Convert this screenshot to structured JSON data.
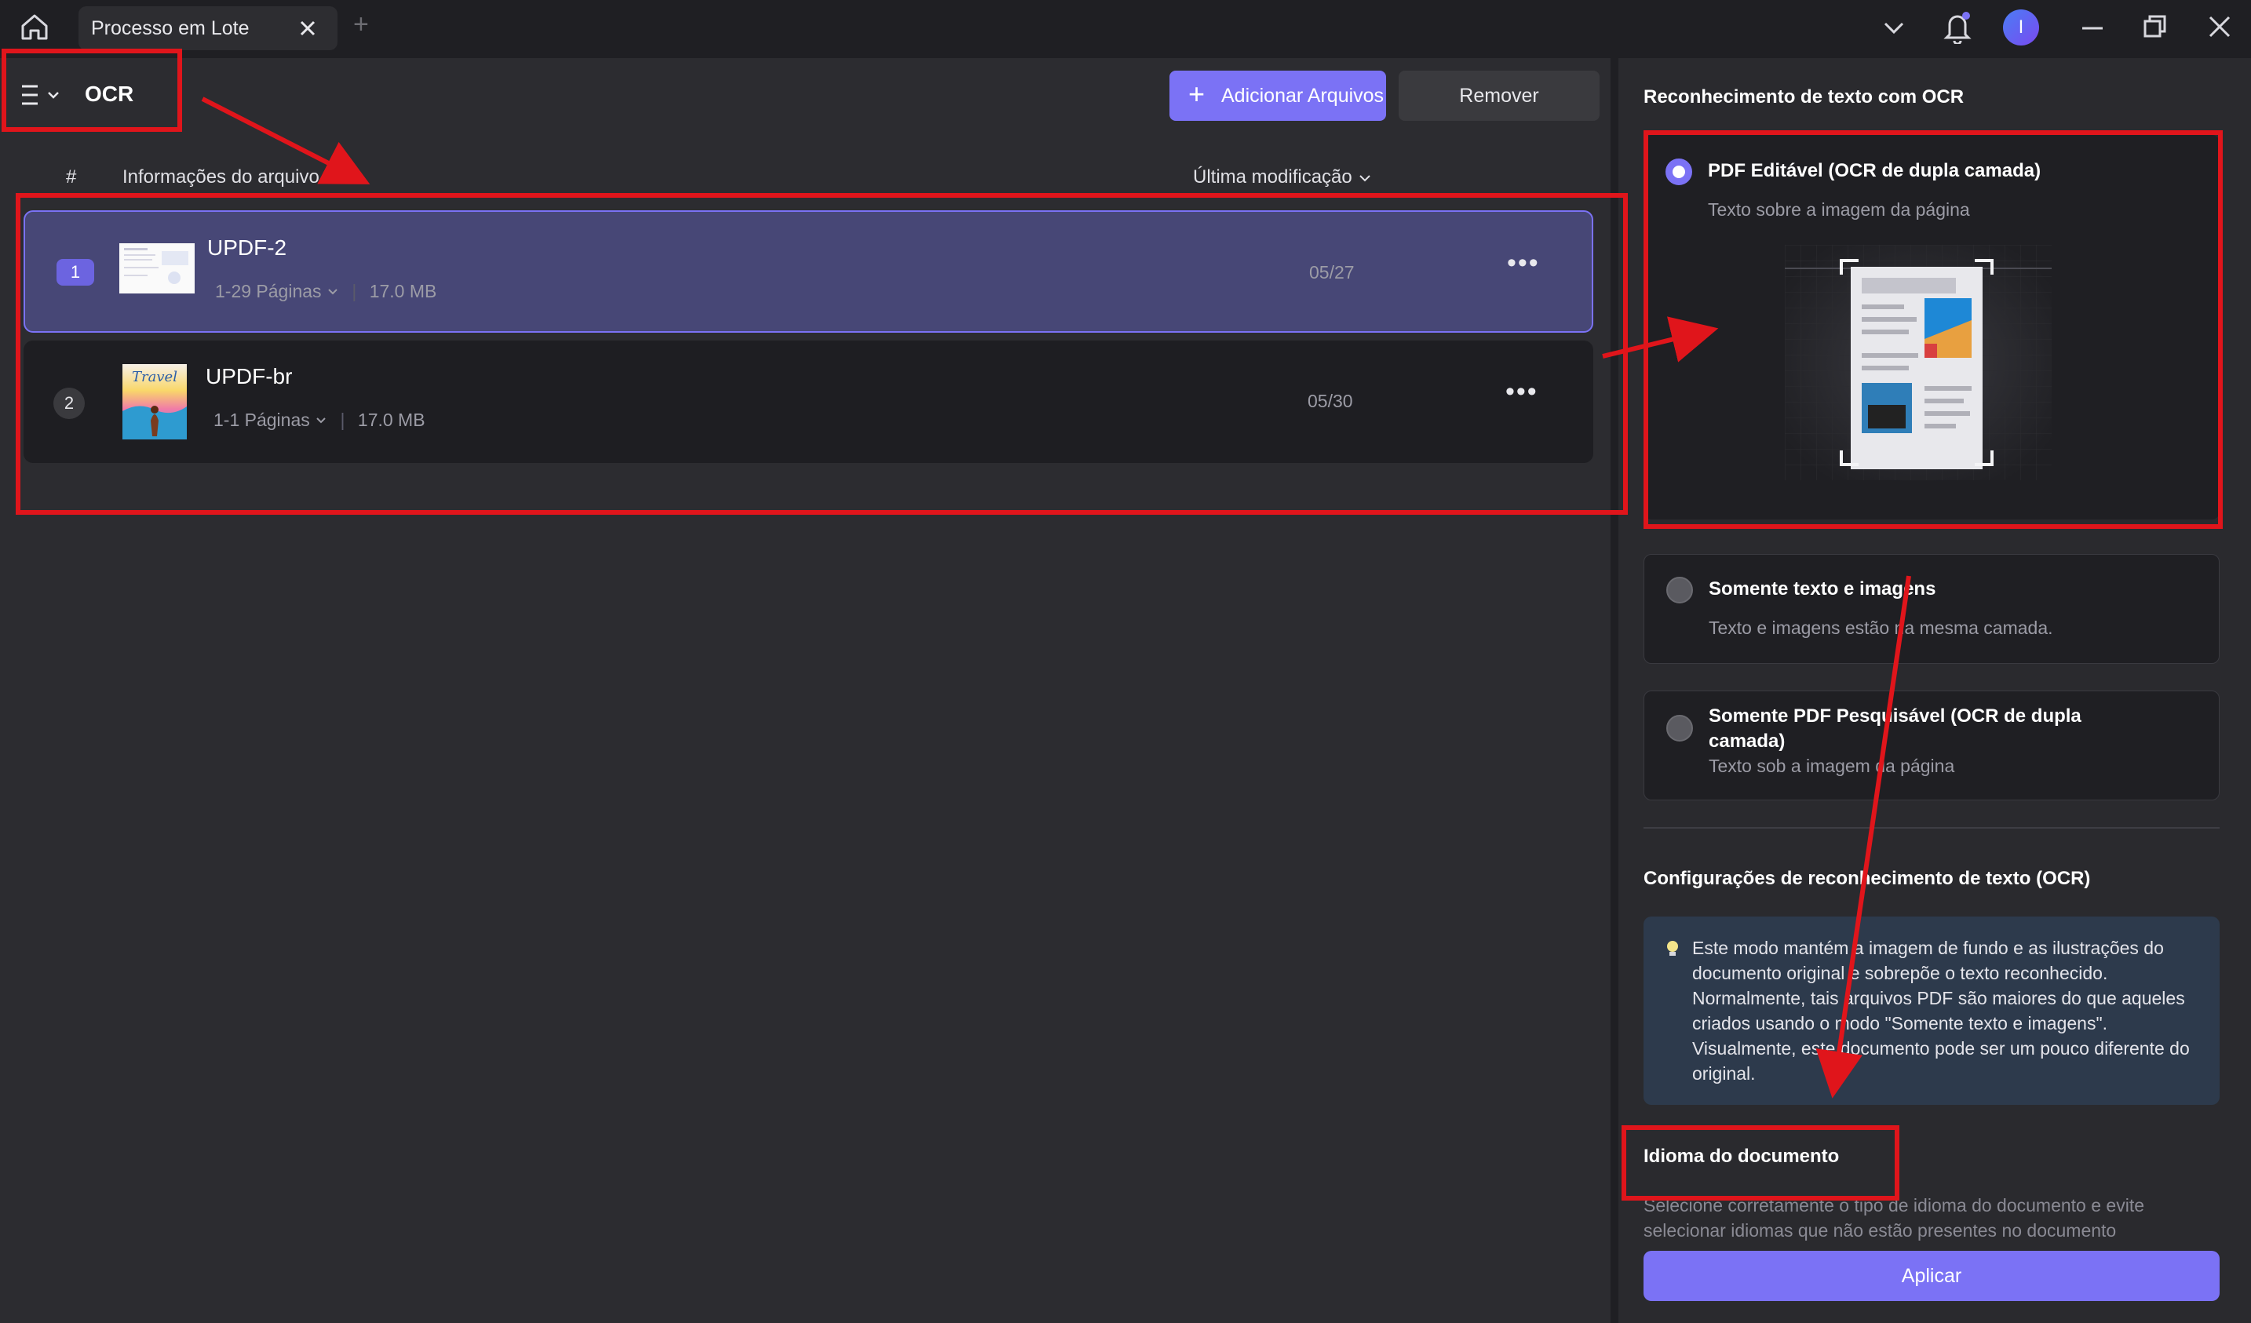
{
  "tab": {
    "label": "Processo em Lote"
  },
  "toolbar": {
    "mode_title": "OCR",
    "add_files_label": "Adicionar Arquivos",
    "remove_label": "Remover"
  },
  "user": {
    "initial": "I"
  },
  "file_list": {
    "headers": {
      "index": "#",
      "info": "Informações do arquivo",
      "modified": "Última modificação"
    },
    "files": [
      {
        "num": "1",
        "name": "UPDF-2",
        "pages": "1-29 Páginas",
        "size": "17.0 MB",
        "date": "05/27",
        "selected": true
      },
      {
        "num": "2",
        "name": "UPDF-br",
        "pages": "1-1 Páginas",
        "size": "17.0 MB",
        "date": "05/30",
        "selected": false
      }
    ]
  },
  "ocr_panel": {
    "title": "Reconhecimento de texto com OCR",
    "options": [
      {
        "title": "PDF Editável (OCR de dupla camada)",
        "desc": "Texto sobre a imagem da página",
        "selected": true
      },
      {
        "title": "Somente texto e imagens",
        "desc": "Texto e imagens estão na mesma camada.",
        "selected": false
      },
      {
        "title": "Somente PDF Pesquisável (OCR de dupla camada)",
        "desc": "Texto sob a imagem da página",
        "selected": false
      }
    ],
    "settings_title": "Configurações de reconhecimento de texto (OCR)",
    "info_text": "Este modo mantém a imagem de fundo e as ilustrações do documento original e sobrepõe o texto reconhecido. Normalmente, tais arquivos PDF são maiores do que aqueles criados usando o modo \"Somente texto e imagens\". Visualmente, este documento pode ser um pouco diferente do original.",
    "language_title": "Idioma do documento",
    "language_desc": "Selecione corretamente o tipo de idioma do documento e evite selecionar idiomas que não estão presentes no documento",
    "apply_label": "Aplicar"
  },
  "colors": {
    "accent": "#7b72f5",
    "annotation": "#e0151b",
    "selected_row": "#474776"
  },
  "thumbnail_texts": {
    "travel_cover": "Travel"
  }
}
